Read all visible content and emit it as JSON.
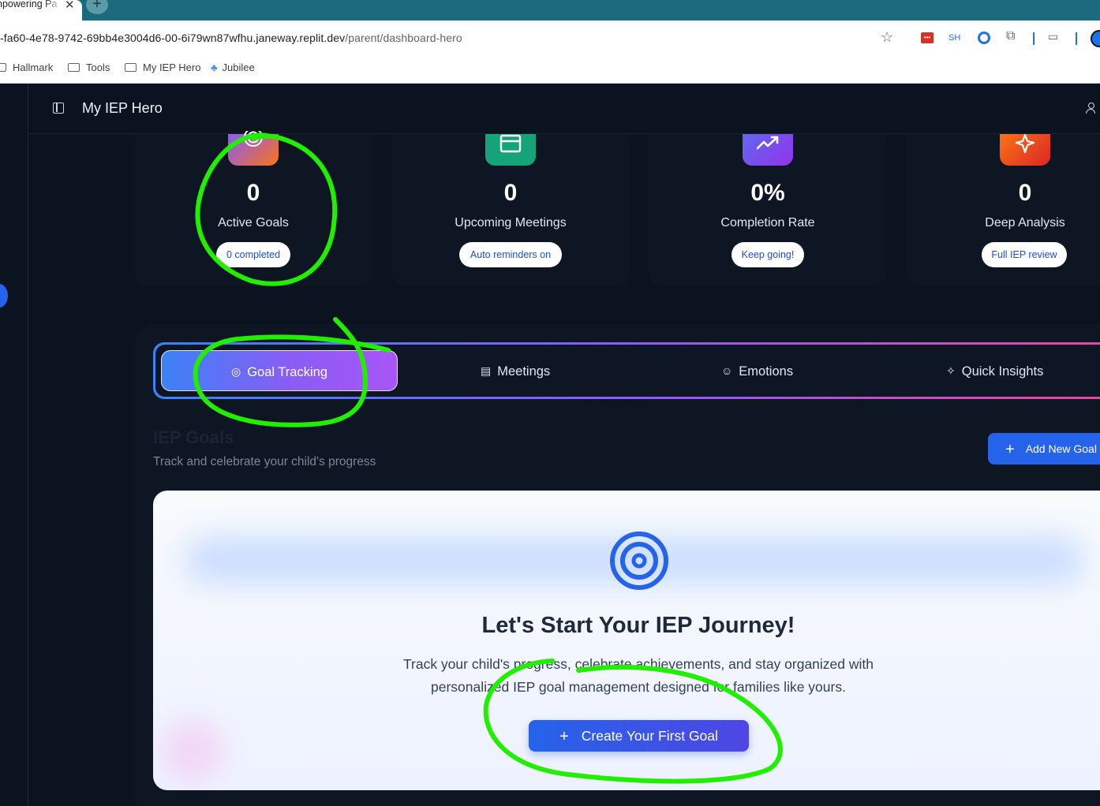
{
  "browser": {
    "tab_title": "npowering Pa",
    "tab_close": "✕",
    "new_tab": "+",
    "url_main": "-fa60-4e78-9742-69bb4e3004d6-00-6i79wn87wfhu.janeway.replit.dev",
    "url_path": "/parent/dashboard-hero",
    "ext_sh": "SH",
    "bookmarks": [
      "Hallmark",
      "Tools",
      "My IEP Hero",
      "Jubilee"
    ]
  },
  "app": {
    "title": "My IEP Hero"
  },
  "stats": [
    {
      "value": "0",
      "label": "Active Goals",
      "pill": "0 completed",
      "icon": "target-icon",
      "color": "#e06a50"
    },
    {
      "value": "0",
      "label": "Upcoming Meetings",
      "pill": "Auto reminders on",
      "icon": "calendar-icon",
      "color": "#16a37a"
    },
    {
      "value": "0%",
      "label": "Completion Rate",
      "pill": "Keep going!",
      "icon": "trending-up-icon",
      "color": "#7c3aed"
    },
    {
      "value": "0",
      "label": "Deep Analysis",
      "pill": "Full IEP review",
      "icon": "sparkle-icon",
      "color": "#ea3d1c"
    }
  ],
  "tabs": [
    {
      "label": "Goal Tracking",
      "icon": "target-icon"
    },
    {
      "label": "Meetings",
      "icon": "calendar-icon"
    },
    {
      "label": "Emotions",
      "icon": "smile-icon"
    },
    {
      "label": "Quick Insights",
      "icon": "sparkles-icon"
    }
  ],
  "section": {
    "title": "IEP Goals",
    "subtitle": "Track and celebrate your child's progress",
    "add_button": "Add New Goal"
  },
  "empty_state": {
    "title": "Let's Start Your IEP Journey!",
    "text": "Track your child's progress, celebrate achievements, and stay organized with personalized IEP goal management designed for families like yours.",
    "button": "Create Your First Goal"
  },
  "annotations": {
    "color": "#22ee00"
  }
}
